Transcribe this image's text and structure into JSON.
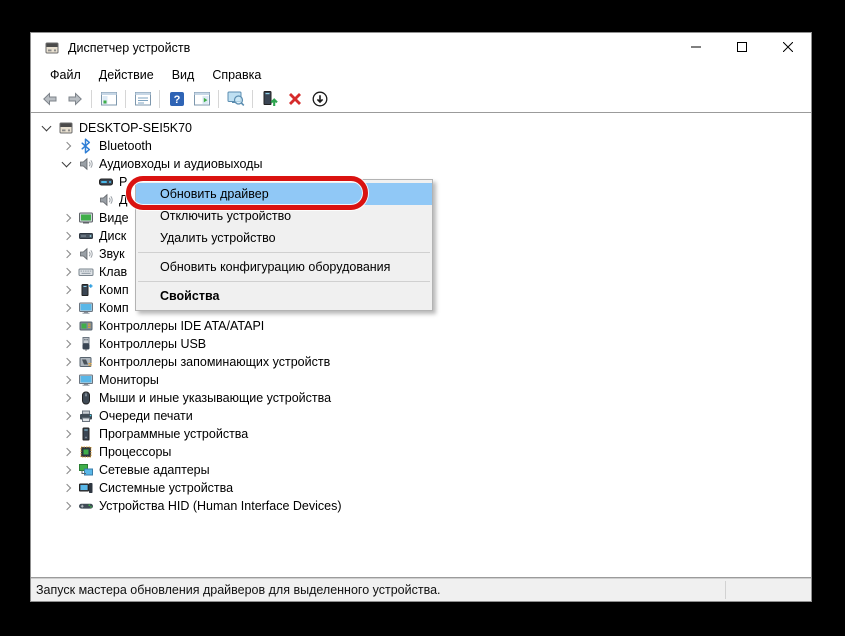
{
  "window": {
    "title": "Диспетчер устройств"
  },
  "menubar": {
    "items": [
      "Файл",
      "Действие",
      "Вид",
      "Справка"
    ]
  },
  "toolbar": {
    "buttons": [
      {
        "icon": "back"
      },
      {
        "icon": "forward"
      },
      {
        "sep": true
      },
      {
        "icon": "show-console-tree"
      },
      {
        "sep": true
      },
      {
        "icon": "properties"
      },
      {
        "sep": true
      },
      {
        "icon": "help"
      },
      {
        "icon": "action-pane"
      },
      {
        "sep": true
      },
      {
        "icon": "scan-hardware"
      },
      {
        "sep": true
      },
      {
        "icon": "update-driver"
      },
      {
        "icon": "uninstall-device"
      },
      {
        "icon": "disable-device"
      }
    ]
  },
  "tree": {
    "items": [
      {
        "label": "DESKTOP-SEI5K70",
        "icon": "device-manager",
        "level": 0,
        "state": "expanded"
      },
      {
        "label": "Bluetooth",
        "icon": "bluetooth",
        "level": 1,
        "state": "collapsed"
      },
      {
        "label": "Аудиовходы и аудиовыходы",
        "icon": "speaker",
        "level": 1,
        "state": "expanded"
      },
      {
        "label": "Р",
        "icon": "audio-device",
        "level": 2,
        "state": "leaf"
      },
      {
        "label": "Д",
        "icon": "speaker",
        "level": 2,
        "state": "leaf"
      },
      {
        "label": "Виде",
        "icon": "video-adapter",
        "level": 1,
        "state": "collapsed"
      },
      {
        "label": "Диск",
        "icon": "disk-drive",
        "level": 1,
        "state": "collapsed"
      },
      {
        "label": "Звук",
        "icon": "speaker",
        "level": 1,
        "state": "collapsed"
      },
      {
        "label": "Клав",
        "icon": "keyboard",
        "level": 1,
        "state": "collapsed"
      },
      {
        "label": "Комп",
        "icon": "software-component",
        "level": 1,
        "state": "collapsed"
      },
      {
        "label": "Комп",
        "icon": "computer",
        "level": 1,
        "state": "collapsed"
      },
      {
        "label": "Контроллеры IDE ATA/ATAPI",
        "icon": "ide-controller",
        "level": 1,
        "state": "collapsed"
      },
      {
        "label": "Контроллеры USB",
        "icon": "usb",
        "level": 1,
        "state": "collapsed"
      },
      {
        "label": "Контроллеры запоминающих устройств",
        "icon": "storage-controller",
        "level": 1,
        "state": "collapsed"
      },
      {
        "label": "Мониторы",
        "icon": "monitor",
        "level": 1,
        "state": "collapsed"
      },
      {
        "label": "Мыши и иные указывающие устройства",
        "icon": "mouse",
        "level": 1,
        "state": "collapsed"
      },
      {
        "label": "Очереди печати",
        "icon": "printer",
        "level": 1,
        "state": "collapsed"
      },
      {
        "label": "Программные устройства",
        "icon": "software-device",
        "level": 1,
        "state": "collapsed"
      },
      {
        "label": "Процессоры",
        "icon": "processor",
        "level": 1,
        "state": "collapsed"
      },
      {
        "label": "Сетевые адаптеры",
        "icon": "network-adapter",
        "level": 1,
        "state": "collapsed"
      },
      {
        "label": "Системные устройства",
        "icon": "system-device",
        "level": 1,
        "state": "collapsed"
      },
      {
        "label": "Устройства HID (Human Interface Devices)",
        "icon": "hid",
        "level": 1,
        "state": "collapsed"
      }
    ]
  },
  "context_menu": {
    "items": [
      {
        "label": "Обновить драйвер",
        "highlighted": true
      },
      {
        "label": "Отключить устройство"
      },
      {
        "label": "Удалить устройство"
      },
      {
        "separator": true
      },
      {
        "label": "Обновить конфигурацию оборудования"
      },
      {
        "separator": true
      },
      {
        "label": "Свойства",
        "bold": true
      }
    ]
  },
  "statusbar": {
    "text": "Запуск мастера обновления драйверов для выделенного устройства."
  },
  "colors": {
    "highlight": "#90c8f6",
    "annotation": "#da1210",
    "menu_bg": "#f0f0f0"
  }
}
